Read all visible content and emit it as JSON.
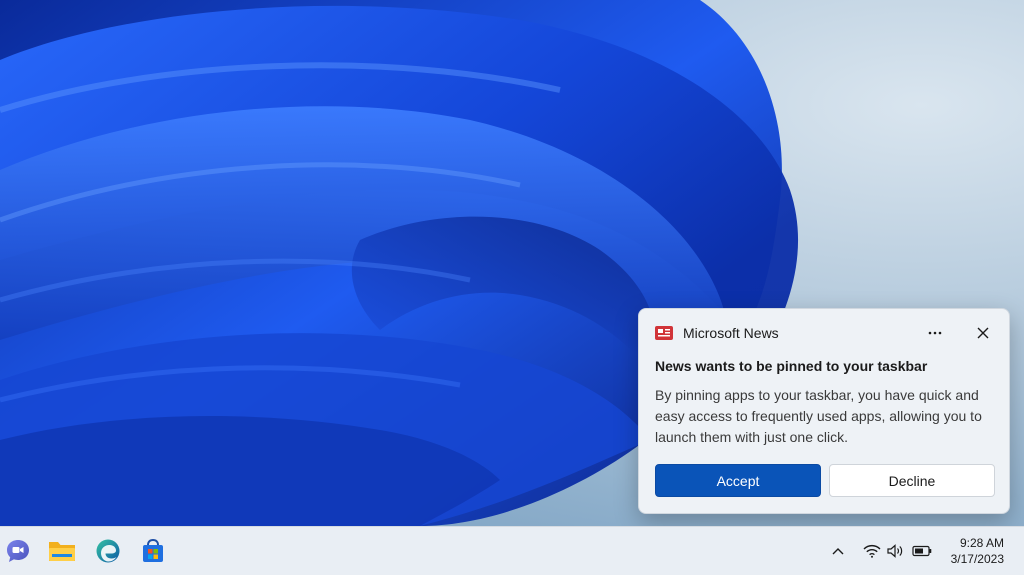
{
  "notification": {
    "app_name": "Microsoft News",
    "app_icon": "news-icon",
    "title": "News wants to be pinned to your taskbar",
    "body": "By pinning apps to your taskbar, you have quick and easy access to frequently used apps, allowing you to launch them with just one click.",
    "accept_label": "Accept",
    "decline_label": "Decline",
    "accent_color": "#0a54b8"
  },
  "taskbar": {
    "apps": [
      {
        "name": "teams-chat-icon"
      },
      {
        "name": "file-explorer-icon"
      },
      {
        "name": "edge-icon"
      },
      {
        "name": "microsoft-store-icon"
      }
    ],
    "tray": {
      "icons": [
        "chevron-up-icon",
        "wifi-icon",
        "volume-icon",
        "battery-icon"
      ],
      "time": "9:28 AM",
      "date": "3/17/2023"
    }
  }
}
